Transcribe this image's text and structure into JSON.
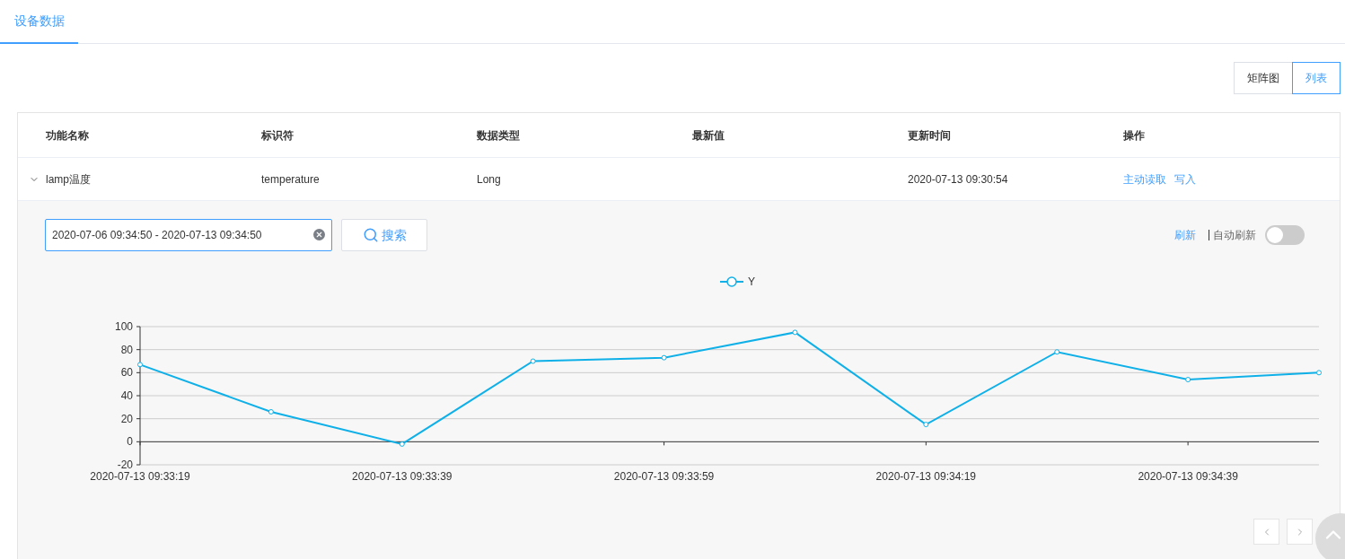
{
  "tabs": [
    {
      "label": "设备数据",
      "selected": true
    }
  ],
  "view_toggle": [
    {
      "label": "矩阵图",
      "selected": false
    },
    {
      "label": "列表",
      "selected": true
    }
  ],
  "table": {
    "columns": [
      "功能名称",
      "标识符",
      "数据类型",
      "最新值",
      "更新时间",
      "操作"
    ],
    "rows": [
      {
        "expanded": true,
        "cells": [
          "lamp温度",
          "temperature",
          "Long",
          "",
          "2020-07-13 09:30:54"
        ],
        "actions": [
          "主动读取",
          "写入"
        ]
      }
    ]
  },
  "detail": {
    "date_range": {
      "value": "2020-07-06 09:34:50 - 2020-07-13 09:34:50"
    },
    "search_button": "搜索",
    "refresh_link": "刷新",
    "auto_refresh": {
      "label": "自动刷新",
      "on": false
    },
    "chart_data": {
      "type": "line",
      "categories": [
        "2020-07-13 09:33:19",
        null,
        "2020-07-13 09:33:39",
        null,
        "2020-07-13 09:33:59",
        null,
        "2020-07-13 09:34:19",
        null,
        "2020-07-13 09:34:39",
        null
      ],
      "grid": true,
      "series": [
        {
          "name": "Y",
          "color": "#0fb0e8",
          "marker": "circle",
          "values": [
            67,
            26,
            -2,
            70,
            73,
            95,
            15,
            78,
            54,
            60
          ]
        }
      ],
      "ylim": [
        -20,
        100
      ],
      "yticks": [
        -20,
        0,
        20,
        40,
        60,
        80,
        100
      ]
    }
  }
}
